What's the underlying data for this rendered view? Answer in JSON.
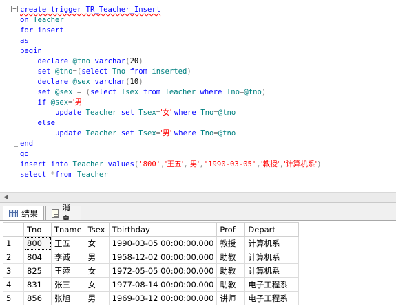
{
  "editor": {
    "lines": [
      [
        {
          "t": "create trigger TR_Teacher_Insert",
          "c": "kw squiggle"
        }
      ],
      [
        {
          "t": "on ",
          "c": "kw"
        },
        {
          "t": "Teacher",
          "c": "obj"
        }
      ],
      [
        {
          "t": "for insert",
          "c": "kw"
        }
      ],
      [
        {
          "t": "as",
          "c": "kw"
        }
      ],
      [
        {
          "t": "begin",
          "c": "kw"
        }
      ],
      [
        {
          "t": "    declare ",
          "c": "kw"
        },
        {
          "t": "@tno ",
          "c": "var"
        },
        {
          "t": "varchar",
          "c": "kw"
        },
        {
          "t": "(",
          "c": "op"
        },
        {
          "t": "20",
          "c": "plain"
        },
        {
          "t": ")",
          "c": "op"
        }
      ],
      [
        {
          "t": "    set ",
          "c": "kw"
        },
        {
          "t": "@tno",
          "c": "var"
        },
        {
          "t": "=(",
          "c": "op"
        },
        {
          "t": "select ",
          "c": "kw"
        },
        {
          "t": "Tno ",
          "c": "obj"
        },
        {
          "t": "from ",
          "c": "kw"
        },
        {
          "t": "inserted",
          "c": "obj"
        },
        {
          "t": ")",
          "c": "op"
        }
      ],
      [
        {
          "t": "    declare ",
          "c": "kw"
        },
        {
          "t": "@sex ",
          "c": "var"
        },
        {
          "t": "varchar",
          "c": "kw"
        },
        {
          "t": "(",
          "c": "op"
        },
        {
          "t": "10",
          "c": "plain"
        },
        {
          "t": ")",
          "c": "op"
        }
      ],
      [
        {
          "t": "    set ",
          "c": "kw"
        },
        {
          "t": "@sex ",
          "c": "var"
        },
        {
          "t": "= (",
          "c": "op"
        },
        {
          "t": "select ",
          "c": "kw"
        },
        {
          "t": "Tsex ",
          "c": "obj"
        },
        {
          "t": "from ",
          "c": "kw"
        },
        {
          "t": "Teacher ",
          "c": "obj"
        },
        {
          "t": "where ",
          "c": "kw"
        },
        {
          "t": "Tno",
          "c": "obj"
        },
        {
          "t": "=",
          "c": "op"
        },
        {
          "t": "@tno",
          "c": "var"
        },
        {
          "t": ")",
          "c": "op"
        }
      ],
      [
        {
          "t": "    if ",
          "c": "kw"
        },
        {
          "t": "@sex",
          "c": "var"
        },
        {
          "t": "=",
          "c": "op"
        },
        {
          "t": "'男'",
          "c": "str cjk"
        }
      ],
      [
        {
          "t": "        update ",
          "c": "kw"
        },
        {
          "t": "Teacher ",
          "c": "obj"
        },
        {
          "t": "set ",
          "c": "kw"
        },
        {
          "t": "Tsex",
          "c": "obj"
        },
        {
          "t": "=",
          "c": "op"
        },
        {
          "t": "'女' ",
          "c": "str cjk"
        },
        {
          "t": "where ",
          "c": "kw"
        },
        {
          "t": "Tno",
          "c": "obj"
        },
        {
          "t": "=",
          "c": "op"
        },
        {
          "t": "@tno",
          "c": "var"
        }
      ],
      [
        {
          "t": "    else",
          "c": "kw"
        }
      ],
      [
        {
          "t": "        update ",
          "c": "kw"
        },
        {
          "t": "Teacher ",
          "c": "obj"
        },
        {
          "t": "set ",
          "c": "kw"
        },
        {
          "t": "Tsex",
          "c": "obj"
        },
        {
          "t": "=",
          "c": "op"
        },
        {
          "t": "'男' ",
          "c": "str cjk"
        },
        {
          "t": "where ",
          "c": "kw"
        },
        {
          "t": "Tno",
          "c": "obj"
        },
        {
          "t": "=",
          "c": "op"
        },
        {
          "t": "@tno",
          "c": "var"
        }
      ],
      [
        {
          "t": "end",
          "c": "kw"
        }
      ],
      [
        {
          "t": "go",
          "c": "kw"
        }
      ],
      [
        {
          "t": "insert into ",
          "c": "kw"
        },
        {
          "t": "Teacher ",
          "c": "obj"
        },
        {
          "t": "values",
          "c": "kw"
        },
        {
          "t": "(",
          "c": "op"
        },
        {
          "t": "'800'",
          "c": "str"
        },
        {
          "t": ",",
          "c": "op"
        },
        {
          "t": "'王五'",
          "c": "str cjk"
        },
        {
          "t": ",",
          "c": "op"
        },
        {
          "t": "'男'",
          "c": "str cjk"
        },
        {
          "t": ",",
          "c": "op"
        },
        {
          "t": "'1990-03-05'",
          "c": "str"
        },
        {
          "t": ",",
          "c": "op"
        },
        {
          "t": "'教授'",
          "c": "str cjk"
        },
        {
          "t": ",",
          "c": "op"
        },
        {
          "t": "'计算机系'",
          "c": "str cjk"
        },
        {
          "t": ")",
          "c": "op"
        }
      ],
      [
        {
          "t": "select ",
          "c": "kw"
        },
        {
          "t": "*",
          "c": "op"
        },
        {
          "t": "from ",
          "c": "kw"
        },
        {
          "t": "Teacher",
          "c": "obj"
        }
      ]
    ]
  },
  "tabs": {
    "results_label": "结果",
    "messages_label": "消息"
  },
  "grid": {
    "columns": [
      "Tno",
      "Tname",
      "Tsex",
      "Tbirthday",
      "Prof",
      "Depart"
    ],
    "rows": [
      [
        "1",
        "800",
        "王五",
        "女",
        "1990-03-05 00:00:00.000",
        "教授",
        "计算机系"
      ],
      [
        "2",
        "804",
        "李诚",
        "男",
        "1958-12-02 00:00:00.000",
        "助教",
        "计算机系"
      ],
      [
        "3",
        "825",
        "王萍",
        "女",
        "1972-05-05 00:00:00.000",
        "助教",
        "计算机系"
      ],
      [
        "4",
        "831",
        "张三",
        "女",
        "1977-08-14 00:00:00.000",
        "助教",
        "电子工程系"
      ],
      [
        "5",
        "856",
        "张旭",
        "男",
        "1969-03-12 00:00:00.000",
        "讲师",
        "电子工程系"
      ]
    ]
  },
  "colors": {
    "keyword": "#0000ff",
    "identifier": "#008080",
    "string": "#ff0000",
    "operator": "#808080"
  }
}
